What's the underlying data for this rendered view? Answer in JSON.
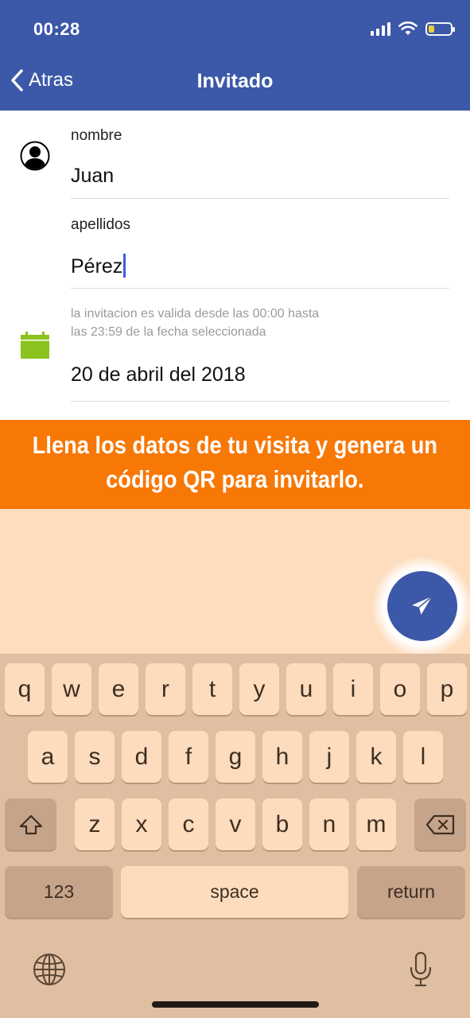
{
  "status_bar": {
    "time": "00:28"
  },
  "nav": {
    "back_label": "Atras",
    "title": "Invitado"
  },
  "form": {
    "nombre_label": "nombre",
    "nombre_value": "Juan",
    "apellidos_label": "apellidos",
    "apellidos_value": "Pérez",
    "hint_line1": "la invitacion es valida desde las 00:00 hasta",
    "hint_line2": "las 23:59 de la fecha seleccionada",
    "date_value": "20 de abril del 2018"
  },
  "banner": {
    "line1": "Llena los datos de tu visita y genera un",
    "line2": "código QR para invitarlo."
  },
  "keyboard": {
    "row1": [
      "q",
      "w",
      "e",
      "r",
      "t",
      "y",
      "u",
      "i",
      "o",
      "p"
    ],
    "row2": [
      "a",
      "s",
      "d",
      "f",
      "g",
      "h",
      "j",
      "k",
      "l"
    ],
    "row3": [
      "z",
      "x",
      "c",
      "v",
      "b",
      "n",
      "m"
    ],
    "numbers_label": "123",
    "space_label": "space",
    "return_label": "return"
  },
  "colors": {
    "header": "#3c58a8",
    "banner": "#f87806",
    "calendar": "#8cc21f",
    "keyboard_bg": "#e0bea1"
  },
  "icons": [
    "back-chevron-icon",
    "wifi-icon",
    "battery-icon",
    "user-icon",
    "calendar-icon",
    "send-icon",
    "shift-icon",
    "delete-icon",
    "globe-icon",
    "microphone-icon"
  ]
}
